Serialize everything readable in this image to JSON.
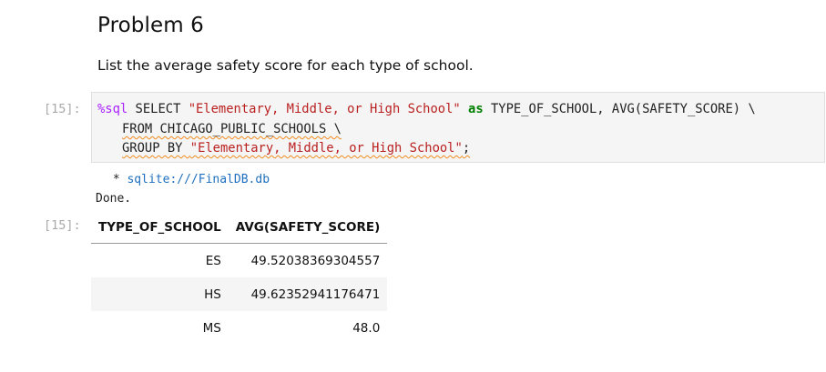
{
  "heading": "Problem 6",
  "description": "List the average safety score for each type of school.",
  "prompts": {
    "input": "[15]:",
    "output": "[15]:"
  },
  "code": {
    "line1": {
      "magic": "%sql",
      "part_a": " SELECT ",
      "string_a": "\"Elementary, Middle, or High School\"",
      "space": " ",
      "keyword": "as",
      "part_b": " TYPE_OF_SCHOOL, AVG(SAFETY_SCORE) \\"
    },
    "line2": "FROM CHICAGO_PUBLIC_SCHOOLS \\",
    "line3": {
      "part_a": "GROUP BY ",
      "string_a": "\"Elementary, Middle, or High School\"",
      "end": ";"
    }
  },
  "output": {
    "star": " * ",
    "connection": "sqlite:///FinalDB.db",
    "status": "Done."
  },
  "table": {
    "headers": [
      "TYPE_OF_SCHOOL",
      "AVG(SAFETY_SCORE)"
    ],
    "rows": [
      [
        "ES",
        "49.52038369304557"
      ],
      [
        "HS",
        "49.62352941176471"
      ],
      [
        "MS",
        "48.0"
      ]
    ]
  },
  "colors": {
    "magic": "#aa22ff",
    "string": "#ba2121",
    "keyword": "#008000",
    "link": "#1f6fbf",
    "squiggle": "#f28b1e"
  }
}
